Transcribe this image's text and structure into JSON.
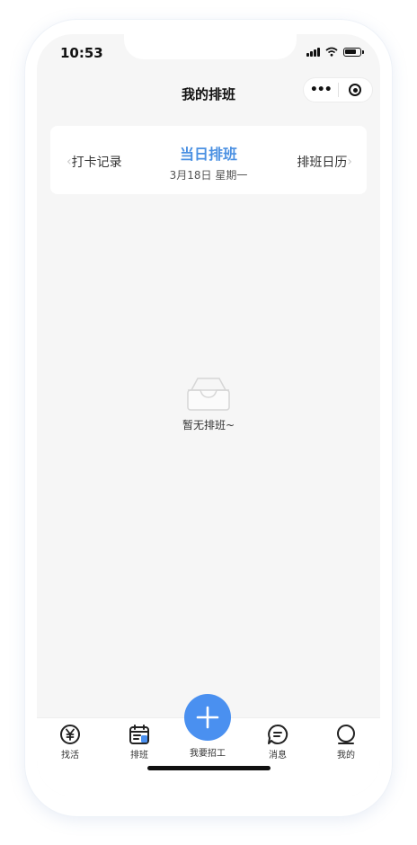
{
  "status_bar": {
    "time": "10:53"
  },
  "nav": {
    "title": "我的排班",
    "more_glyph": "•••"
  },
  "schedule_card": {
    "left_label": "打卡记录",
    "title": "当日排班",
    "date": "3月18日 星期一",
    "right_label": "排班日历",
    "prev_glyph": "‹",
    "next_glyph": "›"
  },
  "empty_state": {
    "text": "暂无排班~"
  },
  "tabbar": {
    "items": [
      {
        "label": "找活",
        "icon": "yen-icon"
      },
      {
        "label": "排班",
        "icon": "calendar-icon"
      },
      {
        "label": "我要招工",
        "icon": "plus-icon"
      },
      {
        "label": "消息",
        "icon": "chat-icon"
      },
      {
        "label": "我的",
        "icon": "person-icon"
      }
    ]
  },
  "colors": {
    "accent": "#4a90e2",
    "fab": "#4a90f0",
    "background": "#f6f6f6"
  }
}
